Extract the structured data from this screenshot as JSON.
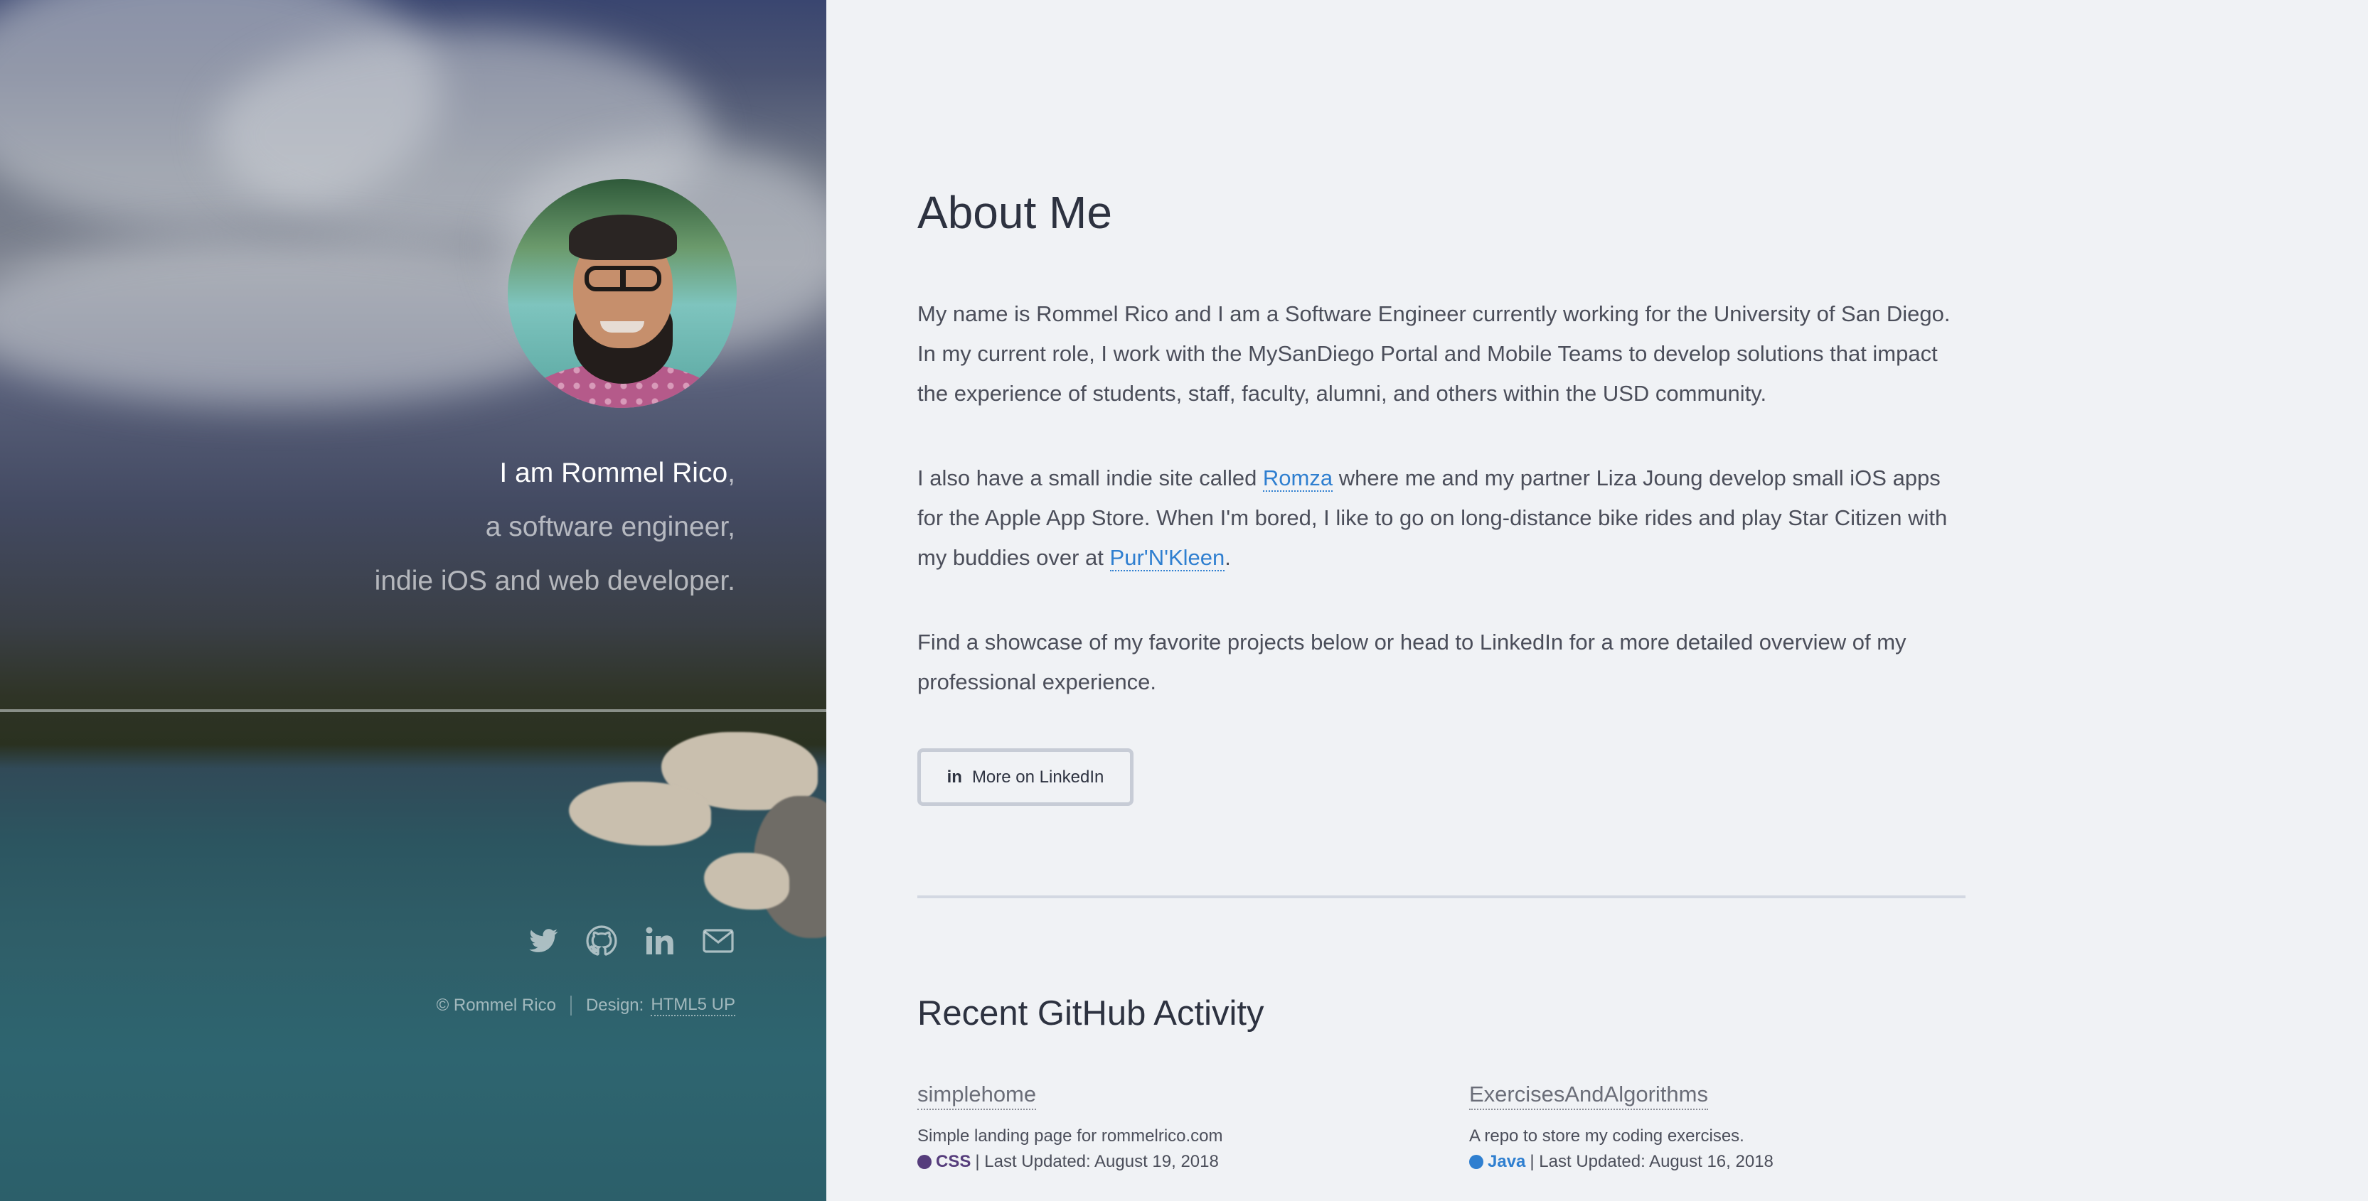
{
  "header": {
    "intro_name": "I am Rommel Rico",
    "intro_comma": ",",
    "intro_line2": "a software engineer,",
    "intro_line3": "indie iOS and web developer.",
    "social": [
      {
        "icon": "twitter-icon"
      },
      {
        "icon": "github-icon"
      },
      {
        "icon": "linkedin-icon"
      },
      {
        "icon": "email-icon"
      }
    ],
    "copyright": "© Rommel Rico",
    "design_label": "Design:",
    "design_link": "HTML5 UP"
  },
  "about": {
    "title": "About Me",
    "p1": "My name is Rommel Rico and I am a Software Engineer currently working for the University of San Diego. In my current role, I work with the MySanDiego Portal and Mobile Teams to develop solutions that impact the experience of students, staff, faculty, alumni, and others within the USD community.",
    "p2_a": "I also have a small indie site called ",
    "p2_link1": "Romza",
    "p2_b": " where me and my partner Liza Joung develop small iOS apps for the Apple App Store. When I'm bored, I like to go on long-distance bike rides and play Star Citizen with my buddies over at ",
    "p2_link2": "Pur'N'Kleen",
    "p2_c": ".",
    "p3": "Find a showcase of my favorite projects below or head to LinkedIn for a more detailed overview of my professional experience.",
    "linkedin_button_icon": "in",
    "linkedin_button": "More on LinkedIn"
  },
  "github": {
    "title": "Recent GitHub Activity",
    "repos": [
      {
        "name": "simplehome",
        "description": "Simple landing page for rommelrico.com",
        "language": "CSS",
        "language_color": "#563d7c",
        "updated": "| Last Updated: August 19, 2018"
      },
      {
        "name": "ExercisesAndAlgorithms",
        "description": "A repo to store my coding exercises.",
        "language": "Java",
        "language_color": "#2f7fd0",
        "updated": "| Last Updated: August 16, 2018"
      }
    ]
  },
  "colors": {
    "accent_link": "#2f7fd0",
    "css_lang": "#563d7c",
    "java_lang": "#2f7fd0"
  }
}
